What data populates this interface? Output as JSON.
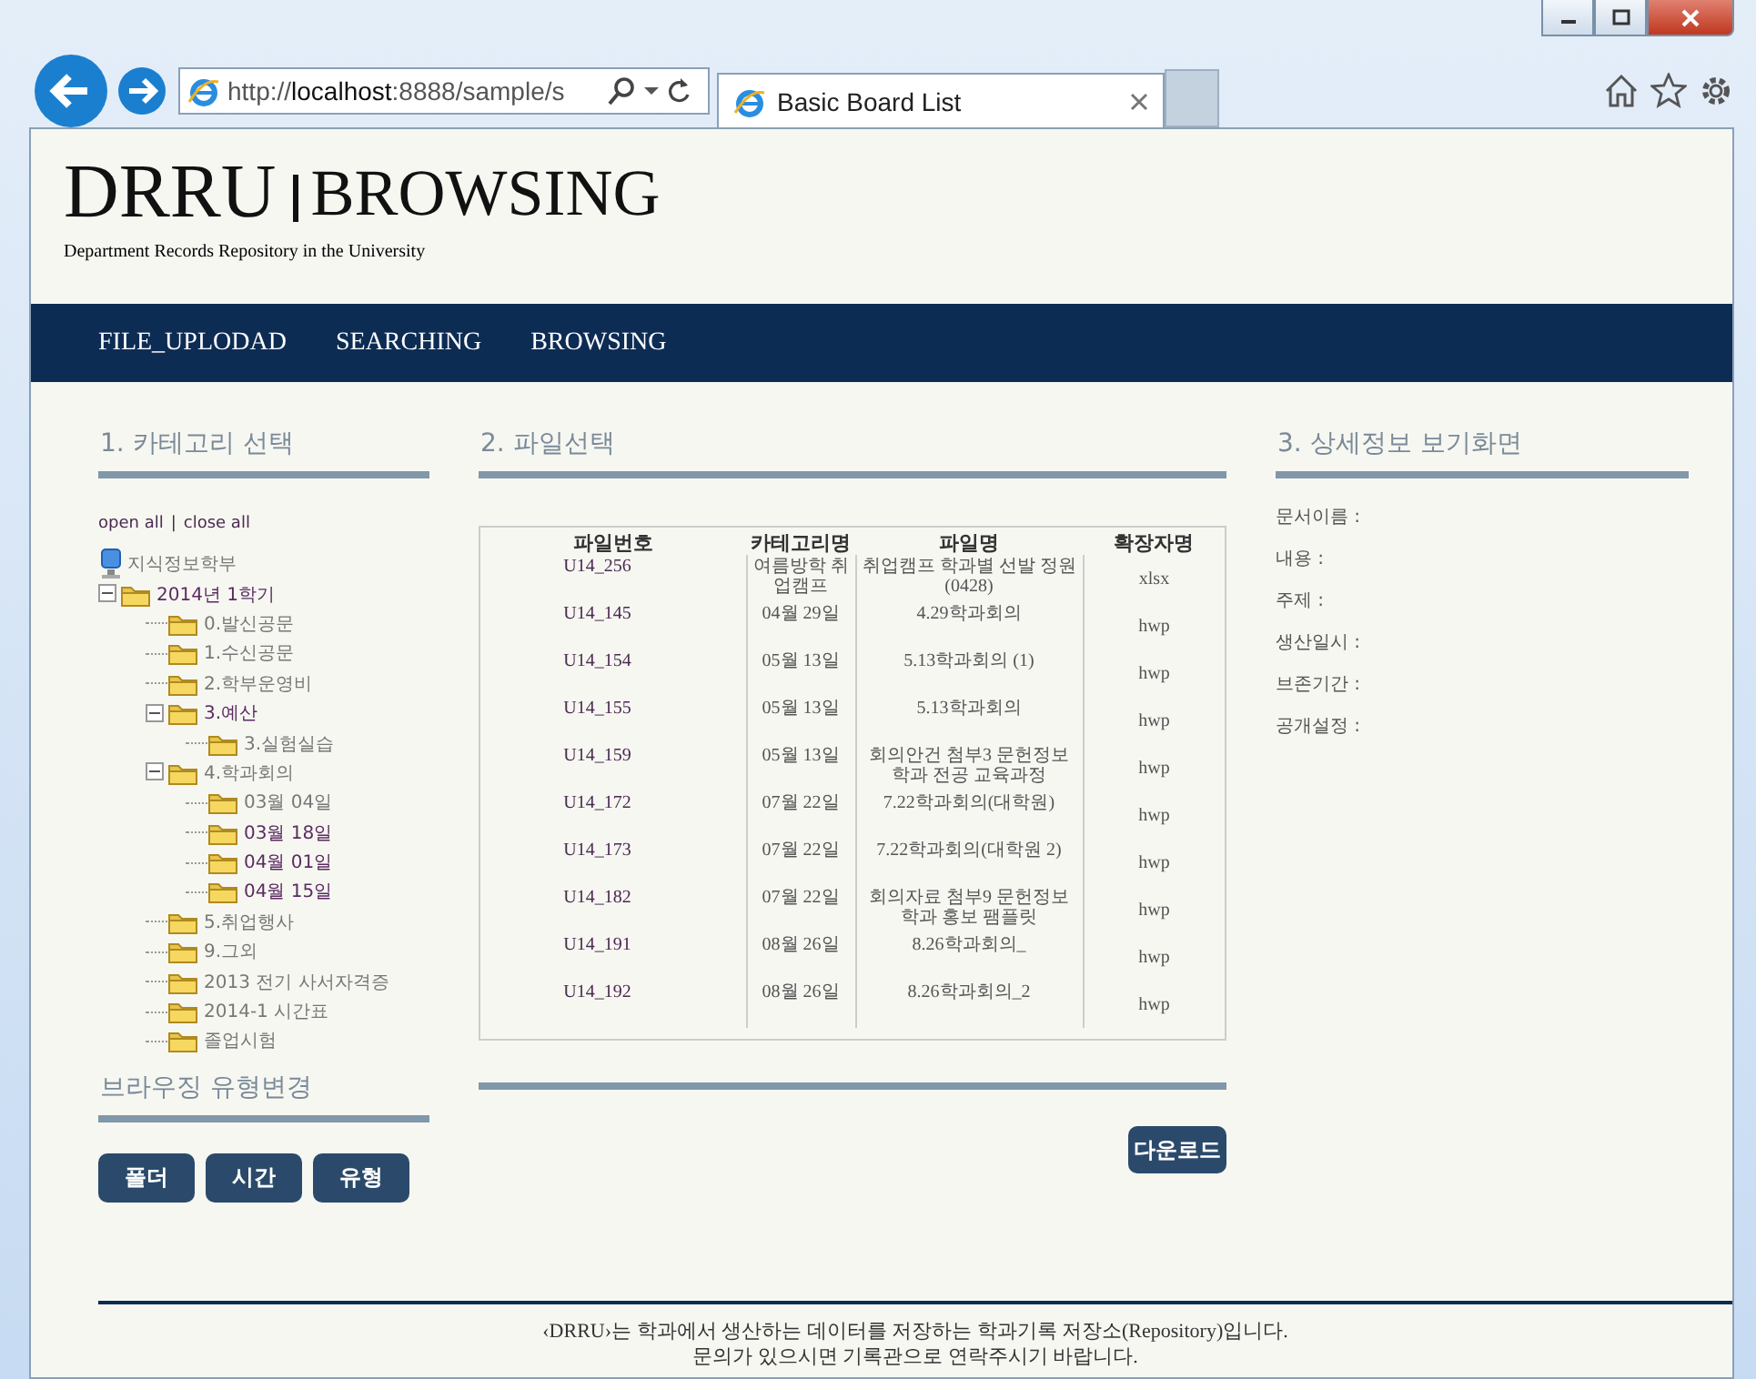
{
  "browser": {
    "address": "http://**localhost**:8888/sample/s",
    "tab_title": "Basic Board List"
  },
  "site": {
    "title": "DRRU",
    "section": "BROWSING",
    "subtitle": "Department Records Repository in the University"
  },
  "nav": [
    "FILE_UPLODAD",
    "SEARCHING",
    "BROWSING"
  ],
  "category": {
    "heading": "1. 카테고리 선택",
    "open_all": "open all",
    "separator": "|",
    "close_all": "close all",
    "tree": [
      {
        "label": "지식정보학부",
        "kind": "root",
        "visited": false,
        "children": [
          {
            "label": "2014년 1학기",
            "kind": "folder",
            "visited": true,
            "expanded": true,
            "children": [
              {
                "label": "0.발신공문",
                "kind": "folder",
                "visited": false
              },
              {
                "label": "1.수신공문",
                "kind": "folder",
                "visited": false
              },
              {
                "label": "2.학부운영비",
                "kind": "folder",
                "visited": false
              },
              {
                "label": "3.예산",
                "kind": "folder",
                "visited": true,
                "expanded": true,
                "children": [
                  {
                    "label": "3.실험실습",
                    "kind": "folder",
                    "visited": false
                  }
                ]
              },
              {
                "label": "4.학과회의",
                "kind": "folder",
                "visited": false,
                "expanded": true,
                "children": [
                  {
                    "label": "03월 04일",
                    "kind": "folder",
                    "visited": false
                  },
                  {
                    "label": "03월 18일",
                    "kind": "folder",
                    "visited": true
                  },
                  {
                    "label": "04월 01일",
                    "kind": "folder",
                    "visited": true
                  },
                  {
                    "label": "04월 15일",
                    "kind": "folder",
                    "visited": true
                  }
                ]
              },
              {
                "label": "5.취업행사",
                "kind": "folder",
                "visited": false
              },
              {
                "label": "9.그외",
                "kind": "folder",
                "visited": false
              },
              {
                "label": "2013 전기 사서자격증",
                "kind": "folder",
                "visited": false
              },
              {
                "label": "2014-1 시간표",
                "kind": "folder",
                "visited": false
              },
              {
                "label": "졸업시험",
                "kind": "folder",
                "visited": false
              }
            ]
          }
        ]
      }
    ]
  },
  "browse_type": {
    "heading": "브라우징 유형변경",
    "buttons": [
      "폴더",
      "시간",
      "유형"
    ]
  },
  "files": {
    "heading": "2. 파일선택",
    "columns": [
      "파일번호",
      "카테고리명",
      "파일명",
      "확장자명"
    ],
    "rows": [
      [
        "U14_256",
        "여름방학 취업캠프",
        "취업캠프 학과별 선발 정원(0428)",
        "xlsx"
      ],
      [
        "U14_145",
        "04월 29일",
        "4.29학과회의",
        "hwp"
      ],
      [
        "U14_154",
        "05월 13일",
        "5.13학과회의 (1)",
        "hwp"
      ],
      [
        "U14_155",
        "05월 13일",
        "5.13학과회의",
        "hwp"
      ],
      [
        "U14_159",
        "05월 13일",
        "회의안건 첨부3 문헌정보학과 전공 교육과정",
        "hwp"
      ],
      [
        "U14_172",
        "07월 22일",
        "7.22학과회의(대학원)",
        "hwp"
      ],
      [
        "U14_173",
        "07월 22일",
        "7.22학과회의(대학원 2)",
        "hwp"
      ],
      [
        "U14_182",
        "07월 22일",
        "회의자료 첨부9 문헌정보학과 홍보 팸플릿",
        "hwp"
      ],
      [
        "U14_191",
        "08월 26일",
        "8.26학과회의_",
        "hwp"
      ],
      [
        "U14_192",
        "08월 26일",
        "8.26학과회의_2",
        "hwp"
      ]
    ],
    "download": "다운로드"
  },
  "detail": {
    "heading": "3. 상세정보 보기화면",
    "fields": [
      "문서이름 :",
      "내용 :",
      "주제 :",
      "생산일시 :",
      "브존기간 :",
      "공개설정 :"
    ]
  },
  "footer": [
    "‹DRRU›는 학과에서 생산하는 데이터를 저장하는 학과기록 저장소(Repository)입니다.",
    "문의가 있으시면 기록관으로 연락주시기 바랍니다."
  ]
}
